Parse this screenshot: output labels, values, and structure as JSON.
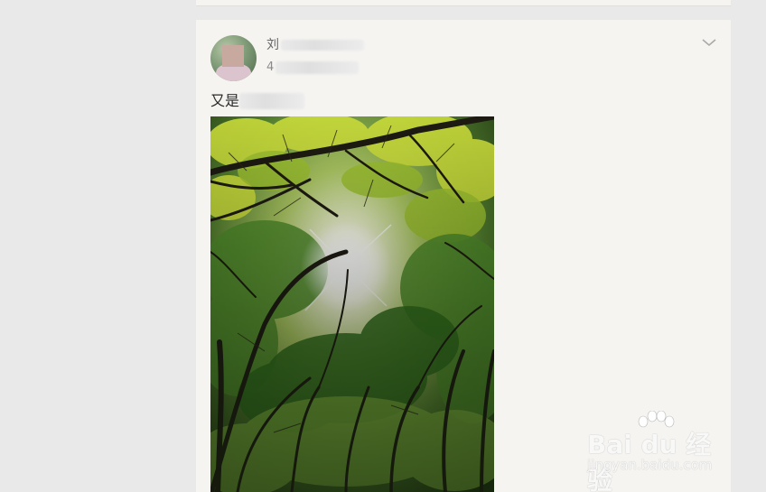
{
  "post": {
    "user_name": "刘",
    "time": "4",
    "text": "又是"
  },
  "watermark": {
    "logo": "Bai du 经验",
    "url": "jingyan.baidu.com"
  },
  "icons": {
    "menu": "chevron-down-icon"
  }
}
